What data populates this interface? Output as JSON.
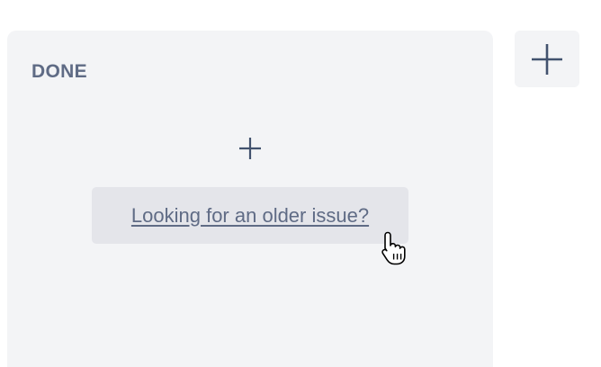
{
  "board": {
    "column": {
      "title": "DONE",
      "add_icon": "plus-icon",
      "older_issue_link": "Looking for an older issue?"
    },
    "add_column_icon": "plus-icon"
  },
  "pointer": {
    "icon": "hand-pointer-cursor-icon"
  },
  "colors": {
    "column_bg": "#f3f4f6",
    "button_bg": "#e4e5ea",
    "text": "#5f6b85",
    "icon": "#42526e"
  }
}
